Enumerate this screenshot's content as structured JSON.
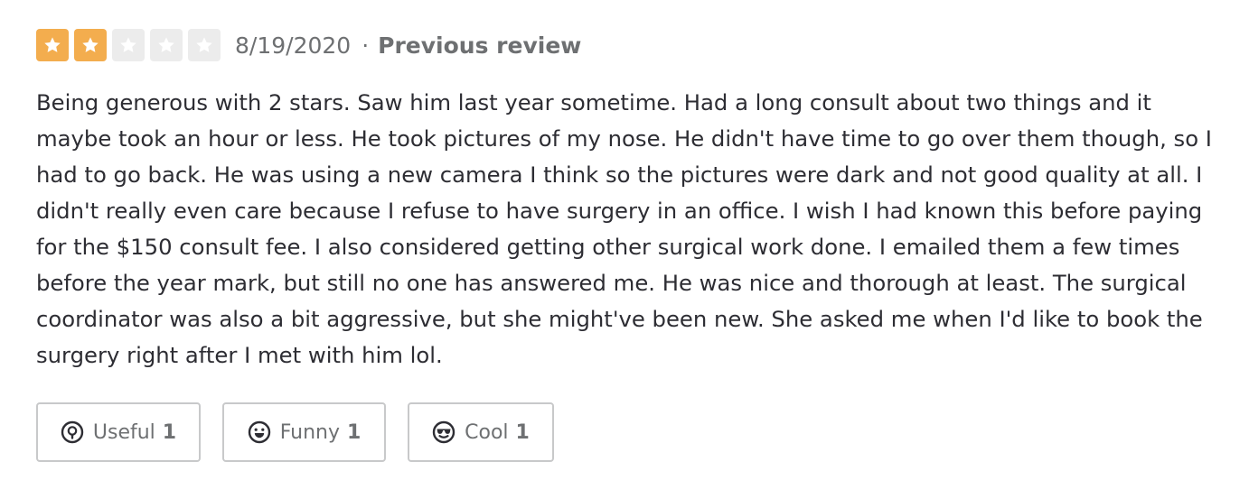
{
  "review": {
    "rating": 2,
    "max_rating": 5,
    "colors": {
      "star_filled": "#f3ad4e",
      "star_empty": "#ececec"
    },
    "date": "8/19/2020",
    "separator": "·",
    "label": "Previous review",
    "text": "Being generous with 2 stars. Saw him last year sometime. Had a long consult about two things and it maybe took an hour or less. He took pictures of my nose. He didn't have time to go over them though, so I had to go back. He was using a new camera I think so the pictures were dark and not good quality at all. I didn't really even care because I refuse to have surgery in an office. I wish I had known this before paying for the $150 consult fee. I also considered getting other surgical work done. I emailed them a few times before the year mark, but still no one has answered me. He was nice and thorough at least. The surgical coordinator was also a bit aggressive, but she might've been new. She asked me when I'd like to book the surgery right after I met with him lol."
  },
  "actions": {
    "useful": {
      "label": "Useful",
      "count": "1",
      "icon": "lightbulb-icon"
    },
    "funny": {
      "label": "Funny",
      "count": "1",
      "icon": "smiley-icon"
    },
    "cool": {
      "label": "Cool",
      "count": "1",
      "icon": "sunglasses-icon"
    }
  }
}
